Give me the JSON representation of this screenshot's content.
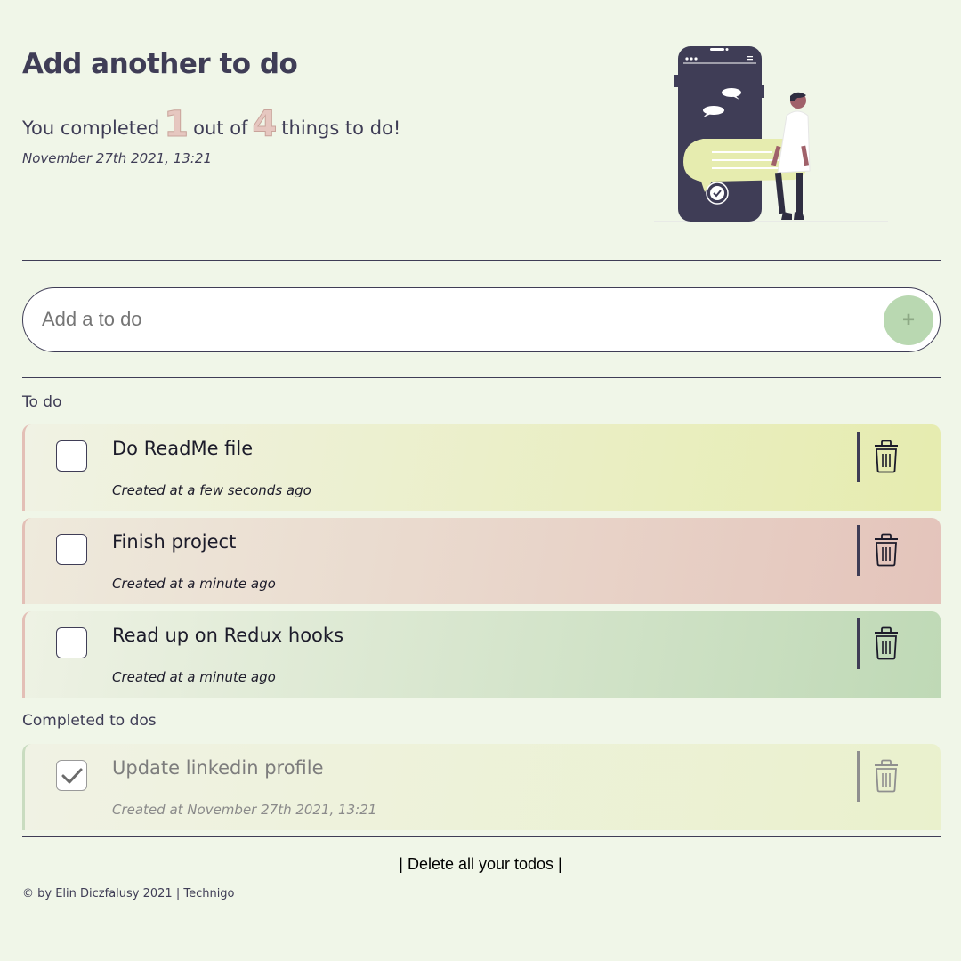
{
  "header": {
    "title": "Add another to do",
    "summary_prefix": "You completed",
    "completed_count": "1",
    "summary_middle": "out of",
    "total_count": "4",
    "summary_suffix": "things to do!",
    "date": "November 27th 2021, 13:21",
    "illustration": "person-holding-phone-with-checkmark"
  },
  "add_form": {
    "placeholder": "Add a to do",
    "value": "",
    "button_icon": "+"
  },
  "todo_section": {
    "label": "To do",
    "items": [
      {
        "text": "Do ReadMe file",
        "created": "Created at a few seconds ago",
        "checked": false,
        "color": "#e6ecaf"
      },
      {
        "text": "Finish project",
        "created": "Created at a minute ago",
        "checked": false,
        "color": "#e4c4bb"
      },
      {
        "text": "Read up on Redux hooks",
        "created": "Created at a minute ago",
        "checked": false,
        "color": "#bfd9b6"
      }
    ]
  },
  "completed_section": {
    "label": "Completed to dos",
    "items": [
      {
        "text": "Update linkedin profile",
        "created": "Created at November 27th 2021, 13:21",
        "checked": true,
        "color": "#eaf1cd"
      }
    ]
  },
  "delete_all_label": "| Delete all your todos |",
  "footer": "© by Elin Diczfalusy 2021 | Technigo",
  "colors": {
    "background": "#f0f6e8",
    "primary": "#3f3d56",
    "accent_green": "#b9d8b1",
    "accent_pink": "#e6c7c0"
  }
}
